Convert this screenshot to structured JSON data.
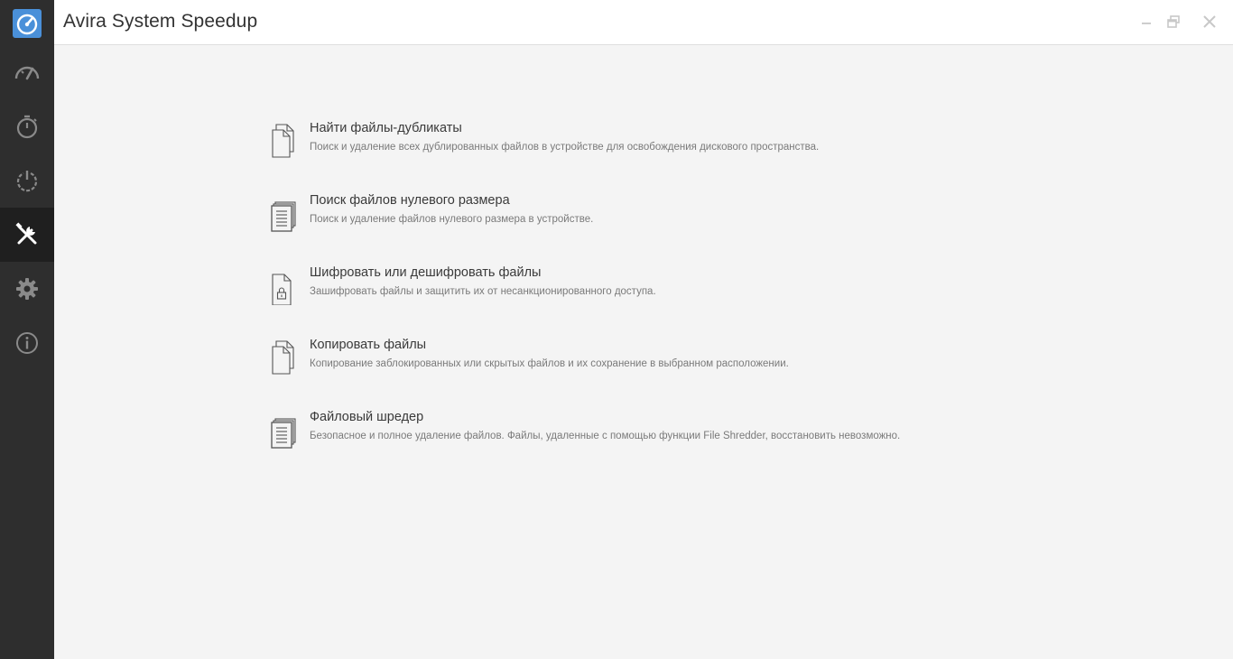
{
  "app": {
    "title": "Avira System Speedup"
  },
  "colors": {
    "sidebar_bg": "#2e2e2e",
    "sidebar_active_bg": "#1f1f1f",
    "logo_blue": "#4a90d9",
    "icon_gray": "#8a8a8a",
    "active_icon": "#ffffff"
  },
  "sidebar": {
    "items": [
      {
        "icon": "speedometer-icon"
      },
      {
        "icon": "stopwatch-icon"
      },
      {
        "icon": "power-startup-icon"
      },
      {
        "icon": "tools-icon",
        "active": true
      },
      {
        "icon": "gear-icon"
      },
      {
        "icon": "info-icon"
      }
    ]
  },
  "window_controls": {
    "minimize_icon": "minimize-icon",
    "restore_icon": "restore-icon",
    "close_icon": "close-icon"
  },
  "tools": [
    {
      "icon": "duplicate-files-icon",
      "title": "Найти файлы-дубликаты",
      "description": "Поиск и удаление всех дублированных файлов в устройстве для освобождения дискового пространства."
    },
    {
      "icon": "stacked-document-icon",
      "title": "Поиск файлов нулевого размера",
      "description": "Поиск и удаление файлов нулевого размера в устройстве."
    },
    {
      "icon": "locked-file-icon",
      "title": "Шифровать или дешифровать файлы",
      "description": "Зашифровать файлы и защитить их от несанкционированного доступа."
    },
    {
      "icon": "copy-files-icon",
      "title": "Копировать файлы",
      "description": "Копирование заблокированных или скрытых файлов и их сохранение в выбранном расположении."
    },
    {
      "icon": "shredder-document-icon",
      "title": "Файловый шредер",
      "description": "Безопасное и полное удаление файлов. Файлы, удаленные с помощью функции File Shredder, восстановить невозможно."
    }
  ]
}
